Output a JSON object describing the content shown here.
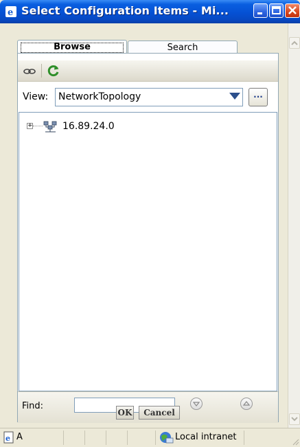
{
  "window": {
    "title": "Select Configuration Items - Mi..."
  },
  "tabs": [
    {
      "label": "Browse",
      "active": true
    },
    {
      "label": "Search",
      "active": false
    }
  ],
  "toolbar": {
    "icons": [
      "link-icon",
      "refresh-icon"
    ]
  },
  "view": {
    "label": "View:",
    "selected": "NetworkTopology",
    "more_label": "..."
  },
  "tree": {
    "items": [
      {
        "label": "16.89.24.0",
        "expanded": false,
        "icon": "network-icon"
      }
    ]
  },
  "find": {
    "label": "Find:",
    "value": "",
    "icons": [
      "find-next-icon",
      "find-previous-icon"
    ]
  },
  "buttons": {
    "ok": "OK",
    "cancel": "Cancel"
  },
  "statusbar": {
    "left": "A",
    "zone": "Local intranet"
  },
  "colors": {
    "titlebar": "#0551d4",
    "window_bg": "#ece9d8",
    "close_button": "#d8471d"
  }
}
